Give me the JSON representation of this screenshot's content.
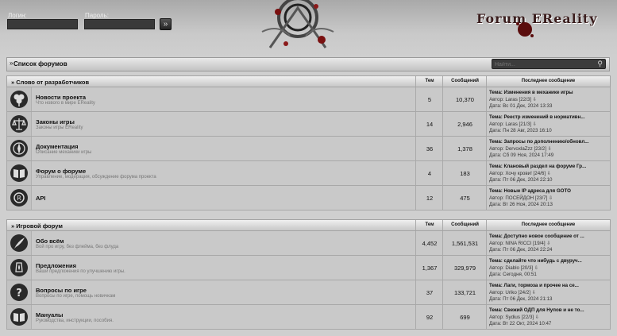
{
  "header": {
    "login_label": "Логин:",
    "password_label": "Пароль:",
    "go_symbol": "»",
    "logo": "Forum EReality"
  },
  "nav": {
    "bullet": "»",
    "title": "Список форумов",
    "search_placeholder": "Найти..."
  },
  "columns": {
    "topics": "Тем",
    "posts": "Сообщений",
    "last": "Последнее сообщение"
  },
  "categories": [
    {
      "title": "» Слово от разработчиков",
      "forums": [
        {
          "icon": "clover-icon",
          "name": "Новости проекта",
          "desc": "Что нового в мире EReality",
          "topics": "5",
          "posts": "10,370",
          "last_topic": "Тема: Изменения в механике игры",
          "last_author": "Автор: Laras [22/3]  ⇩",
          "last_date": "Дата: Вс 01 Дек, 2024 13:33"
        },
        {
          "icon": "scales-icon",
          "name": "Законы игры",
          "desc": "Законы игры EReality",
          "topics": "14",
          "posts": "2,946",
          "last_topic": "Тема: Реестр изменений в нормативн...",
          "last_author": "Автор: Laras [21/3]  ⇩",
          "last_date": "Дата: Пн 28 Авг, 2023 16:10"
        },
        {
          "icon": "compass-icon",
          "name": "Документация",
          "desc": "Описание механики игры",
          "topics": "36",
          "posts": "1,378",
          "last_topic": "Тема: Запросы по дополнению/обновл...",
          "last_author": "Автор: DervoxlaZzz [23/2]  ⇩",
          "last_date": "Дата: Сб 09 Ноя, 2024 17:49"
        },
        {
          "icon": "book-icon",
          "name": "Форум о форуме",
          "desc": "Управление, модерация, обсуждение форума проекта",
          "topics": "4",
          "posts": "183",
          "last_topic": "Тема: Клановый раздел на форуме Гр...",
          "last_author": "Автор: Хочу крови! [24/6]  ⇩",
          "last_date": "Дата: Пт 06 Дек, 2024 22:10"
        },
        {
          "icon": "api-icon",
          "name": "API",
          "desc": "",
          "topics": "12",
          "posts": "475",
          "last_topic": "Тема: Новые IP адреса для GOTO",
          "last_author": "Автор: ПОСЕЙДОН [23/7]  ⇩",
          "last_date": "Дата: Вт 26 Ноя, 2024 20:13"
        }
      ]
    },
    {
      "title": "» Игровой форум",
      "forums": [
        {
          "icon": "quill-icon",
          "name": "Обо всём",
          "desc": "Вой про игру, без флейма, без флуда",
          "topics": "4,452",
          "posts": "1,561,531",
          "last_topic": "Тема: Доступно новое сообщение от ...",
          "last_author": "Автор: NINA RICCI [19/4]  ⇩",
          "last_date": "Дата: Пт 06 Дек, 2024 22:24"
        },
        {
          "icon": "lantern-icon",
          "name": "Предложения",
          "desc": "Ваши предложения по улучшению игры.",
          "topics": "1,367",
          "posts": "329,979",
          "last_topic": "Тема: сделайте что нибудь с двуруч...",
          "last_author": "Автор: Diablo [20/3]  ⇩",
          "last_date": "Дата: Сегодня, 00:51"
        },
        {
          "icon": "question-icon",
          "name": "Вопросы по игре",
          "desc": "Вопросы по игре, помощь новичкам",
          "topics": "37",
          "posts": "133,721",
          "last_topic": "Тема: Лаги, тормоза и прочее на се...",
          "last_author": "Автор: Uriko [24/2]  ⇩",
          "last_date": "Дата: Пт 06 Дек, 2024 21:13"
        },
        {
          "icon": "book-icon",
          "name": "Мануалы",
          "desc": "Руководства, инструкции, пособия.",
          "topics": "92",
          "posts": "699",
          "last_topic": "Тема: Свежий ОДП для Нупов и не то...",
          "last_author": "Автор: Sydius [22/3]  ⇩",
          "last_date": "Дата: Вт 22 Окт, 2024 10:47"
        }
      ]
    }
  ]
}
